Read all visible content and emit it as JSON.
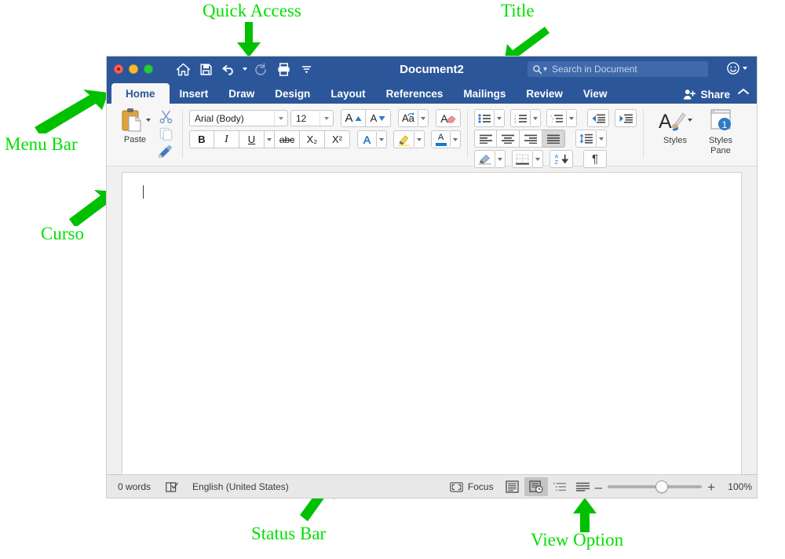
{
  "annotations": [
    {
      "id": "quick-access",
      "label": "Quick Access"
    },
    {
      "id": "title",
      "label": "Title"
    },
    {
      "id": "menu-bar",
      "label": "Menu Bar"
    },
    {
      "id": "cursor",
      "label": "Curso"
    },
    {
      "id": "status-bar",
      "label": "Status Bar"
    },
    {
      "id": "view-option",
      "label": "View Option"
    }
  ],
  "window": {
    "title": "Document2",
    "traffic_lights": [
      "close",
      "minimize",
      "zoom"
    ],
    "quick_access": [
      {
        "name": "home-icon",
        "label": "Home"
      },
      {
        "name": "save-icon",
        "label": "Save"
      },
      {
        "name": "undo-icon",
        "label": "Undo"
      },
      {
        "name": "redo-icon",
        "label": "Redo"
      },
      {
        "name": "print-icon",
        "label": "Print"
      },
      {
        "name": "customize-icon",
        "label": "Customize Quick Access Toolbar"
      }
    ],
    "search": {
      "placeholder": "Search in Document",
      "icon": "search-icon"
    },
    "account_icon": "smiley-icon"
  },
  "tabs": {
    "items": [
      "Home",
      "Insert",
      "Draw",
      "Design",
      "Layout",
      "References",
      "Mailings",
      "Review",
      "View"
    ],
    "active": "Home",
    "share_label": "Share",
    "collapse_icon": "chevron-up-icon"
  },
  "ribbon": {
    "clipboard": {
      "paste_label": "Paste",
      "cut_icon": "scissors-icon",
      "copy_icon": "copy-icon",
      "format_painter_icon": "paintbrush-icon"
    },
    "font": {
      "font_family_value": "Arial (Body)",
      "font_size_value": "12",
      "grow_label": "A",
      "shrink_label": "A",
      "change_case_label": "Aa",
      "clear_formatting_label": "A",
      "bold_label": "B",
      "italic_label": "I",
      "underline_label": "U",
      "strikethrough_label": "abc",
      "subscript_label": "X₂",
      "superscript_label": "X²",
      "text_effects_label": "A",
      "highlight_label": "A",
      "font_color_label": "A"
    },
    "paragraph": {
      "bullets_icon": "bulleted-list-icon",
      "numbering_icon": "numbered-list-icon",
      "multilevel_icon": "multilevel-list-icon",
      "decrease_indent_icon": "decrease-indent-icon",
      "increase_indent_icon": "increase-indent-icon",
      "align_left_icon": "align-left-icon",
      "align_center_icon": "align-center-icon",
      "align_right_icon": "align-right-icon",
      "justify_icon": "justify-icon",
      "line_spacing_icon": "line-spacing-icon",
      "shading_icon": "shading-icon",
      "borders_icon": "borders-icon",
      "sort_icon": "sort-icon",
      "show_marks_label": "¶"
    },
    "styles": {
      "styles_label": "Styles",
      "styles_pane_label": "Styles\nPane",
      "styles_pane_line1": "Styles",
      "styles_pane_line2": "Pane"
    }
  },
  "document": {
    "content": "",
    "caret_visible": true
  },
  "status_bar": {
    "word_count": "0 words",
    "proofing_icon": "proofing-icon",
    "language": "English (United States)",
    "focus_label": "Focus",
    "focus_icon": "focus-icon",
    "read_mode_icon": "read-mode-icon",
    "print_layout_icon": "print-layout-icon",
    "outline_icon": "outline-view-icon",
    "draft_icon": "draft-view-icon",
    "zoom_out_label": "–",
    "zoom_in_label": "+",
    "zoom_value": "100%"
  },
  "colors": {
    "brand_blue": "#2b579a",
    "annotation_green": "#00e000",
    "accent_blue": "#1a79c8"
  }
}
